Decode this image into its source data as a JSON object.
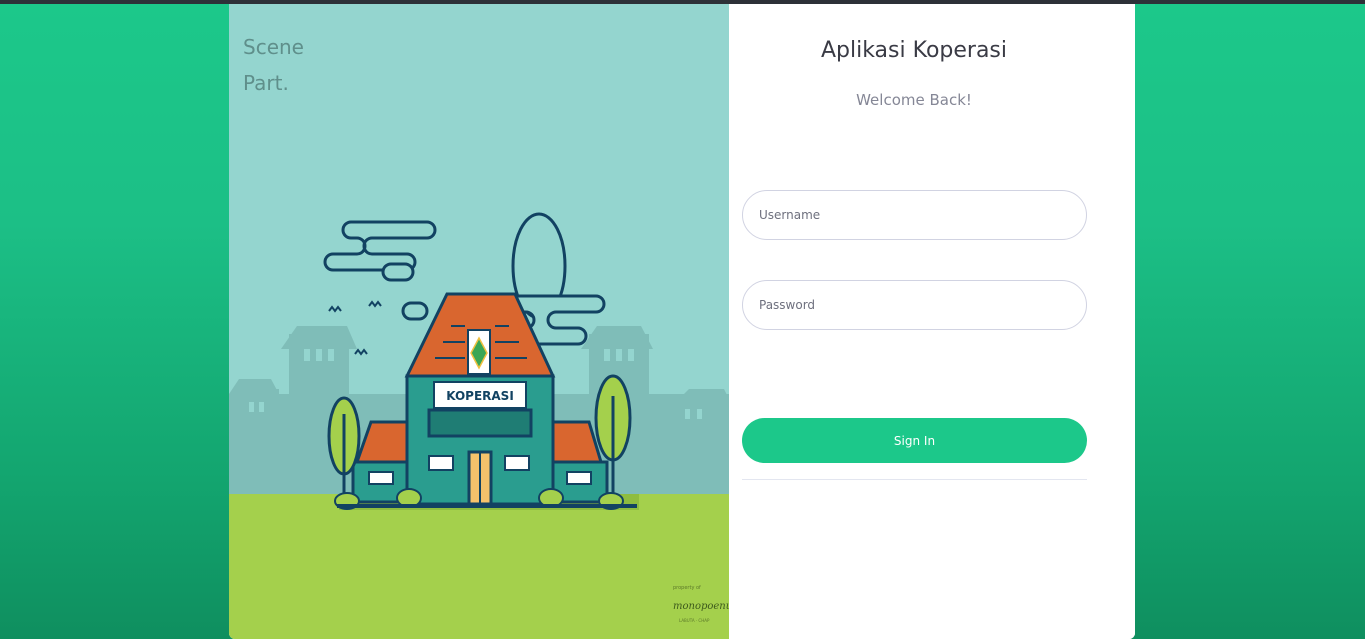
{
  "app": {
    "title": "Aplikasi Koperasi",
    "subtitle": "Welcome Back!"
  },
  "illustration": {
    "watermark_line1": "Scene",
    "watermark_line2": "Part.",
    "sign_text": "KOPERASI",
    "credit_small": "property of",
    "credit_brand": "monopoenuk",
    "credit_sub": "LABUTA · CHAP"
  },
  "login": {
    "username_placeholder": "Username",
    "password_placeholder": "Password",
    "signin_label": "Sign In"
  },
  "colors": {
    "accent": "#1cc88a",
    "sky": "#94d5cf",
    "grass": "#a4d04c",
    "roof": "#d9662f",
    "building": "#2a9d8f"
  }
}
